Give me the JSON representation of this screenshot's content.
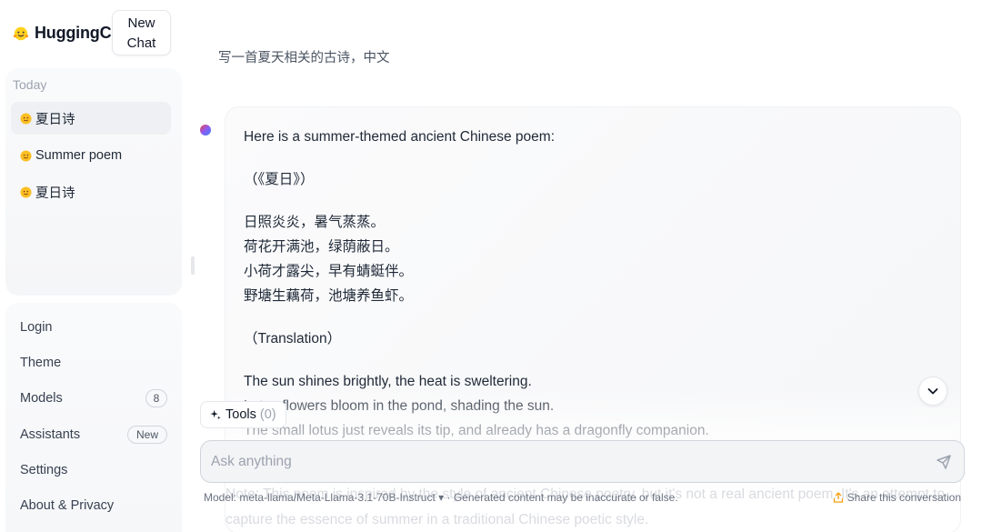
{
  "brand": {
    "name": "HuggingChat",
    "logo_icon": "hugging-face-emoji"
  },
  "sidebar": {
    "new_chat_label": "New Chat",
    "section_label": "Today",
    "conversations": [
      {
        "title": "夏日诗",
        "active": true
      },
      {
        "title": "Summer poem",
        "active": false
      },
      {
        "title": "夏日诗",
        "active": false
      }
    ],
    "menu": {
      "login": "Login",
      "theme": "Theme",
      "models": "Models",
      "models_count": "8",
      "assistants": "Assistants",
      "assistants_badge": "New",
      "settings": "Settings",
      "about": "About & Privacy"
    }
  },
  "chat": {
    "user_message": "写一首夏天相关的古诗，中文",
    "assistant": {
      "intro": "Here is a summer-themed ancient Chinese poem:",
      "poem_title": "（《夏日》）",
      "poem_lines": [
        "日照炎炎，暑气蒸蒸。",
        "荷花开满池，绿荫蔽日。",
        "小荷才露尖，早有蜻蜓伴。",
        "野塘生藕荷，池塘养鱼虾。"
      ],
      "translation_heading": "（Translation）",
      "translation_lines": [
        "The sun shines brightly, the heat is sweltering.",
        "Lotus flowers bloom in the pond, shading the sun.",
        "The small lotus just reveals its tip, and already has a dragonfly companion."
      ],
      "ghost_lines": [
        "Note: This poem is inspired by the style of ancient Chinese poetry, but it's not a real ancient poem. It's an attempt to",
        "capture the essence of summer in a traditional Chinese poetic style."
      ]
    }
  },
  "tools": {
    "label": "Tools",
    "count": "(0)"
  },
  "input": {
    "placeholder": "Ask anything"
  },
  "footer": {
    "model_prefix": "Model:",
    "model_name": "meta-llama/Meta-Llama-3.1-70B-Instruct",
    "disclaimer": "· Generated content may be inaccurate or false.",
    "share_label": "Share this conversation"
  },
  "colors": {
    "accent_dot_start": "#ef4444",
    "accent_dot_end": "#3b82f6",
    "sidebar_bg": "#f9fafb"
  }
}
